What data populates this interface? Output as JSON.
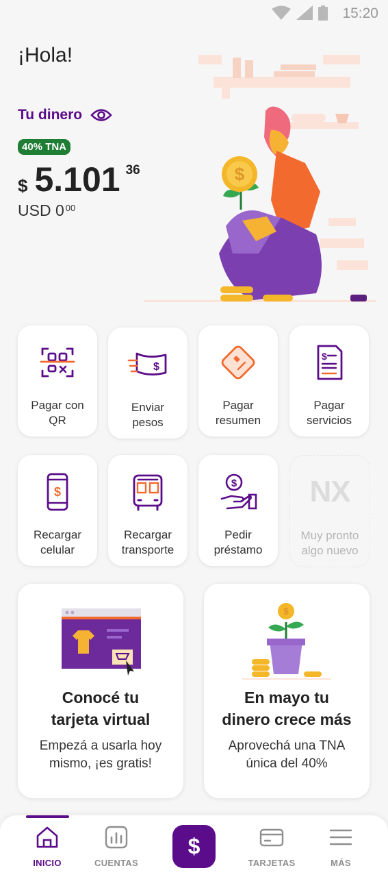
{
  "status_bar": {
    "time": "15:20"
  },
  "header": {
    "greeting": "¡Hola!",
    "money_label": "Tu dinero",
    "tna_badge": "40% TNA",
    "balance": {
      "currency": "$",
      "integer": "5.101",
      "decimals": "36"
    },
    "usd": {
      "label": "USD 0",
      "decimals": "00"
    }
  },
  "actions": [
    {
      "line1": "Pagar con",
      "line2": "QR",
      "icon": "qr-code-icon"
    },
    {
      "line1": "Enviar",
      "line2": "pesos",
      "icon": "money-bill-icon"
    },
    {
      "line1": "Pagar",
      "line2": "resumen",
      "icon": "card-icon"
    },
    {
      "line1": "Pagar",
      "line2": "servicios",
      "icon": "document-icon"
    },
    {
      "line1": "Recargar",
      "line2": "celular",
      "icon": "phone-icon"
    },
    {
      "line1": "Recargar",
      "line2": "transporte",
      "icon": "bus-icon"
    },
    {
      "line1": "Pedir",
      "line2": "préstamo",
      "icon": "loan-hand-icon"
    },
    {
      "badge": "NX",
      "line1": "Muy pronto",
      "line2": "algo nuevo",
      "icon": "nx-logo"
    }
  ],
  "cards": [
    {
      "title1": "Conocé tu",
      "title2": "tarjeta virtual",
      "sub1": "Empezá a usarla hoy",
      "sub2": "mismo, ¡es gratis!"
    },
    {
      "title1": "En mayo tu",
      "title2": "dinero crece más",
      "sub1": "Aprovechá una TNA",
      "sub2": "única del 40%"
    }
  ],
  "nav": {
    "items": [
      {
        "label": "INICIO",
        "icon": "home-icon"
      },
      {
        "label": "CUENTAS",
        "icon": "chart-icon"
      },
      {
        "label": "TARJETAS",
        "icon": "card-icon"
      },
      {
        "label": "MÁS",
        "icon": "menu-icon"
      }
    ],
    "center_symbol": "$"
  },
  "colors": {
    "brand": "#5b0c8a",
    "badge_green": "#1f7d34",
    "accent_orange": "#f26a2e",
    "coin_yellow": "#f5b72a"
  }
}
